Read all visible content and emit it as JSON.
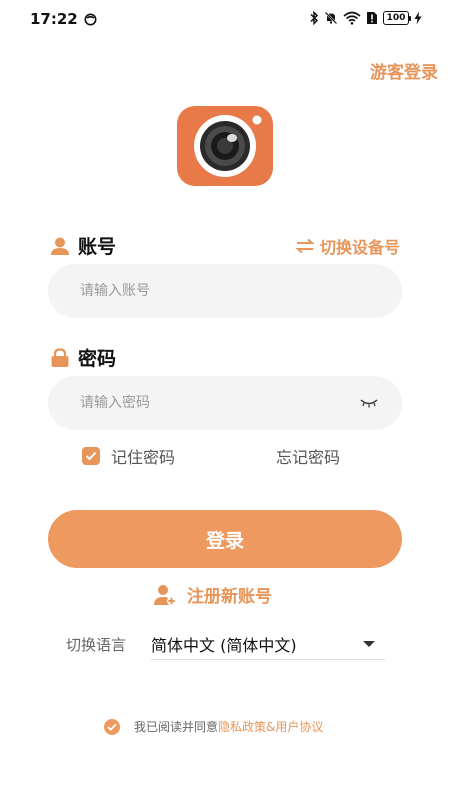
{
  "status_bar": {
    "time": "17:22",
    "battery": "100"
  },
  "header": {
    "guest_login": "游客登录"
  },
  "logo": {
    "icon": "camera-icon",
    "background": "#E87A4A"
  },
  "account": {
    "label": "账号",
    "switch_device": "切换设备号",
    "placeholder": "请输入账号"
  },
  "password": {
    "label": "密码",
    "placeholder": "请输入密码"
  },
  "options": {
    "remember_password": "记住密码",
    "forgot_password": "忘记密码"
  },
  "login_button": "登录",
  "register": "注册新账号",
  "language": {
    "label": "切换语言",
    "selected": "简体中文 (简体中文)"
  },
  "agreement": {
    "prefix": "我已阅读并同意",
    "link": "隐私政策&用户协议"
  },
  "colors": {
    "accent": "#E8955A",
    "button": "#EE9960",
    "input_bg": "#F4F4F4"
  }
}
